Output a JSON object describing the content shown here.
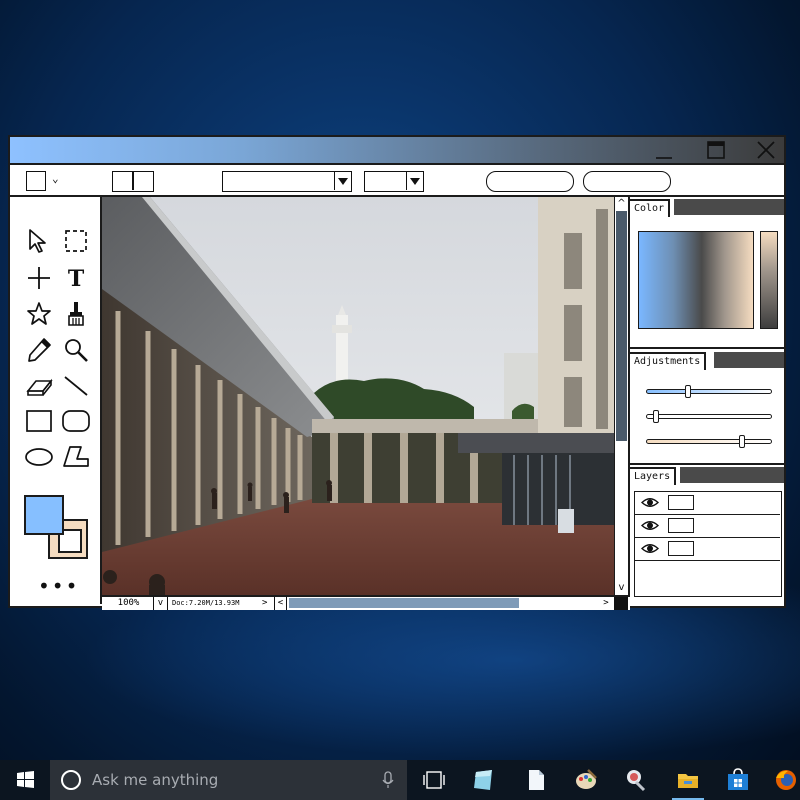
{
  "app": {
    "title_buttons": {
      "minimize": "minimize",
      "maximize": "maximize",
      "close": "close"
    }
  },
  "toolbar": {
    "shape_selector_icon": "square-icon",
    "dropdown1_value": "",
    "dropdown2_value": "",
    "button1_label": "",
    "button2_label": ""
  },
  "tools": [
    "select-arrow-icon",
    "marquee-icon",
    "crosshair-icon",
    "text-icon",
    "star-icon",
    "brush-icon",
    "pencil-icon",
    "zoom-icon",
    "eraser-icon",
    "line-icon",
    "rectangle-icon",
    "rounded-rectangle-icon",
    "ellipse-icon",
    "polygon-icon"
  ],
  "colors": {
    "foreground": "#86bfff",
    "background": "#f5dcc0",
    "accent_dark": "#4a4a4a"
  },
  "more_label": "•••",
  "status": {
    "zoom": "100%",
    "doc": "Doc:7.20M/13.93M"
  },
  "panels": {
    "color_title": "Color",
    "adjustments_title": "Adjustments",
    "layers_title": "Layers"
  },
  "adjustments": {
    "slider1": 0.33,
    "slider2": 0.05,
    "slider3": 0.79
  },
  "layers": [
    {
      "visible": true
    },
    {
      "visible": true
    },
    {
      "visible": true
    }
  ],
  "taskbar": {
    "search_placeholder": "Ask me anything",
    "apps": [
      "task-view-icon",
      "notes-app-icon",
      "document-app-icon",
      "paint-app-icon",
      "network-app-icon",
      "file-explorer-icon",
      "store-icon",
      "firefox-icon"
    ]
  }
}
